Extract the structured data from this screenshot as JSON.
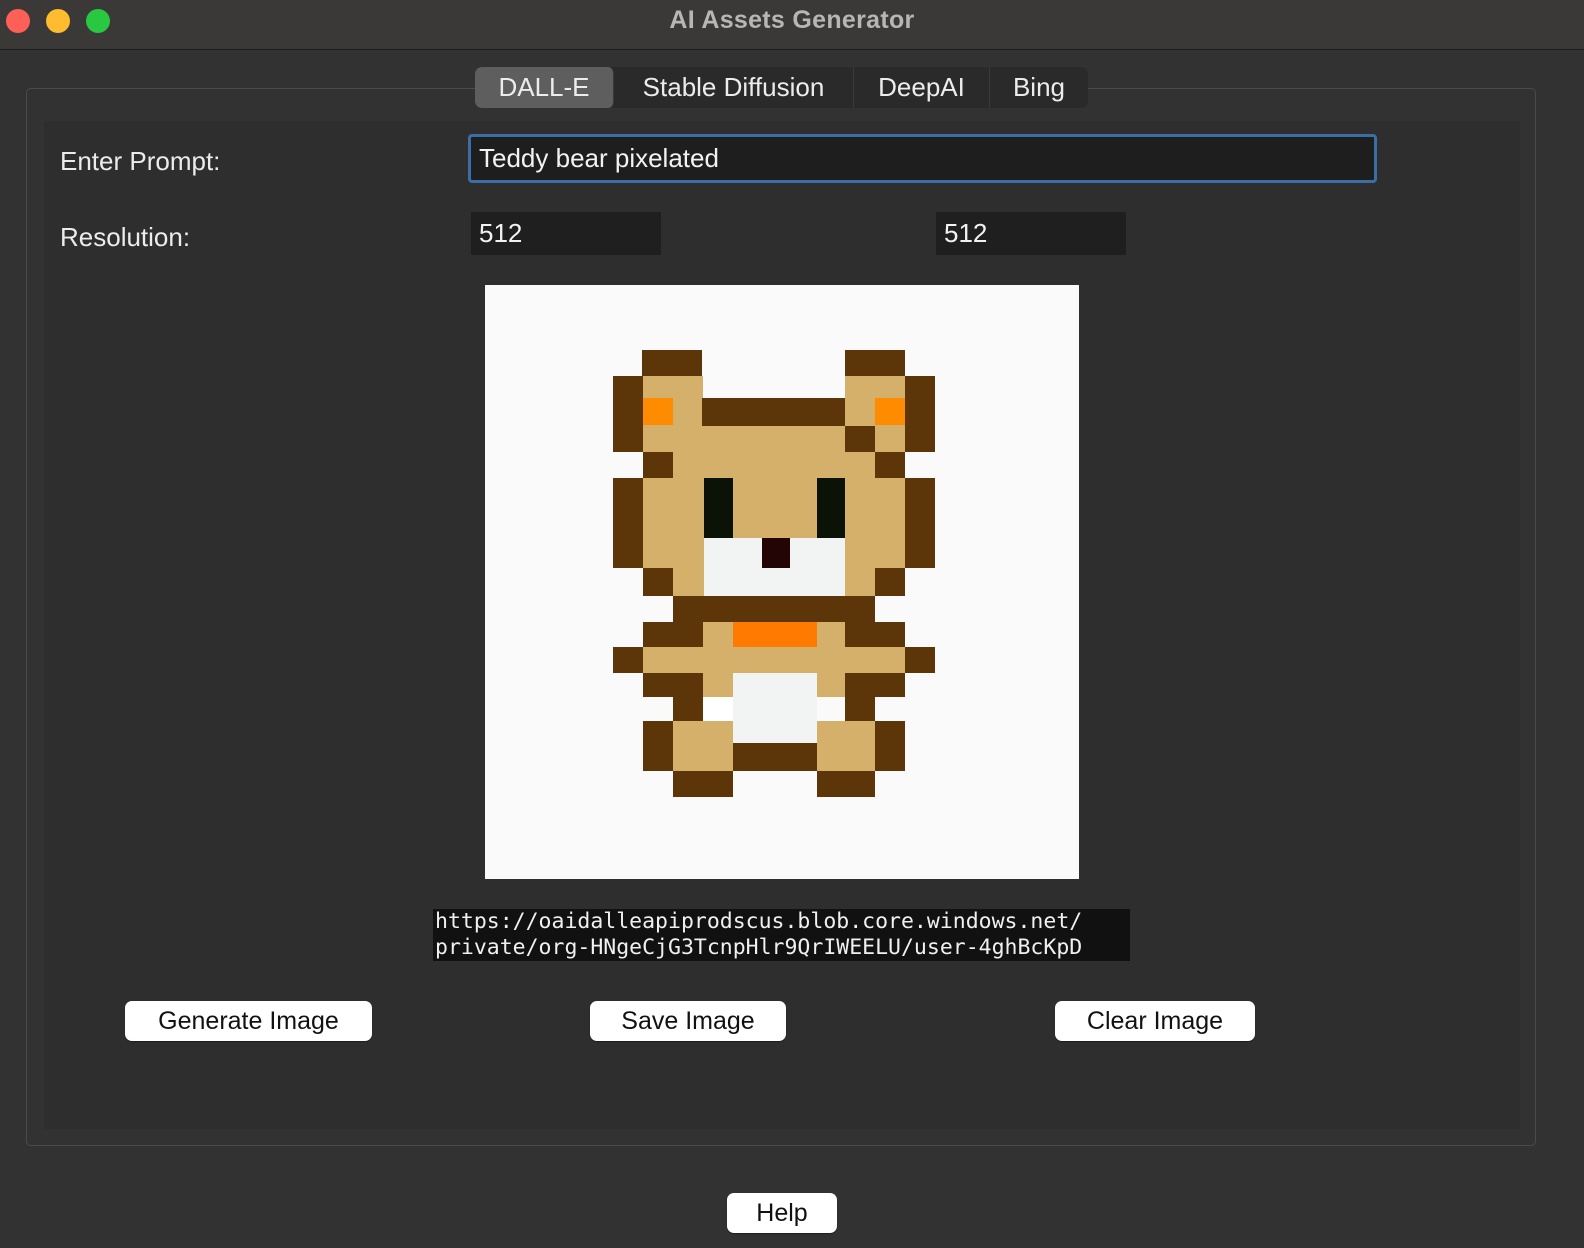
{
  "window": {
    "title": "AI Assets Generator"
  },
  "tabs": [
    {
      "label": "DALL-E",
      "active": true
    },
    {
      "label": "Stable Diffusion",
      "active": false
    },
    {
      "label": "DeepAI",
      "active": false
    },
    {
      "label": "Bing",
      "active": false
    }
  ],
  "form": {
    "prompt_label": "Enter Prompt:",
    "prompt_value": "Teddy bear pixelated",
    "resolution_label": "Resolution:",
    "width_value": "512",
    "height_value": "512"
  },
  "image": {
    "description": "pixel-art teddy bear",
    "url_line1": "https://oaidalleapiprodscus.blob.core.windows.net/",
    "url_line2": "private/org-HNgeCjG3TcnpHlr9QrIWEELU/user-4ghBcKpD"
  },
  "buttons": {
    "generate": "Generate Image",
    "save": "Save Image",
    "clear": "Clear Image",
    "help": "Help"
  },
  "colors": {
    "accent": "#3a6ea5",
    "window_bg": "#323232",
    "bear_dark": "#5c3608",
    "bear_tan": "#d4b06a",
    "bear_orange": "#ff8c00"
  }
}
